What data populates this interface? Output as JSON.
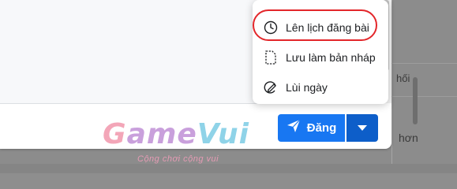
{
  "menu": {
    "items": [
      {
        "label": "Lên lịch đăng bài",
        "icon": "clock-icon"
      },
      {
        "label": "Lưu làm bản nháp",
        "icon": "document-icon"
      },
      {
        "label": "Lùi ngày",
        "icon": "backdate-icon"
      }
    ]
  },
  "actions": {
    "publish_label": "Đăng",
    "dropdown_icon": "caret-down-icon"
  },
  "background": {
    "snippet_top": "hối",
    "snippet_bottom": "hơn"
  },
  "watermark": {
    "brand": "GameVui",
    "tagline": "Cộng chơi cộng vui"
  },
  "colors": {
    "primary": "#1877f2",
    "primary_dark": "#0d5ec9",
    "highlight": "#e3262a"
  }
}
